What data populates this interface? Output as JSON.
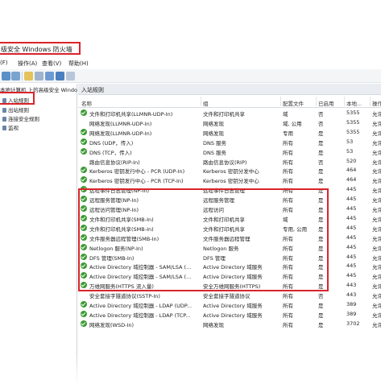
{
  "window": {
    "title": "级安全 Windows 防火墙"
  },
  "menu": [
    {
      "label": "(F)"
    },
    {
      "label": "操作(A)"
    },
    {
      "label": "查看(V)"
    },
    {
      "label": "帮助(H)"
    }
  ],
  "tree": {
    "root": "本地计算机 上的高级安全 Windows",
    "items": [
      {
        "label": "入站规则"
      },
      {
        "label": "出站规则"
      },
      {
        "label": "连接安全规则"
      },
      {
        "label": "监视"
      }
    ]
  },
  "panel": {
    "title": "入站规则"
  },
  "columns": [
    "名称",
    "组",
    "配置文件",
    "已启用",
    "本地...",
    "操作"
  ],
  "rules": [
    {
      "enabled": true,
      "name": "文件和打印机共享(LLMNR-UDP-In)",
      "group": "文件和打印机共享",
      "profile": "域",
      "active": "否",
      "port": "5355",
      "action": "允许"
    },
    {
      "enabled": false,
      "name": "网络发现(LLMNR-UDP-In)",
      "group": "网络发现",
      "profile": "域, 公用",
      "active": "否",
      "port": "5355",
      "action": "允许"
    },
    {
      "enabled": true,
      "name": "网络发现(LLMNR-UDP-In)",
      "group": "网络发现",
      "profile": "专用",
      "active": "是",
      "port": "5355",
      "action": "允许"
    },
    {
      "enabled": true,
      "name": "DNS (UDP，传入)",
      "group": "DNS 服务",
      "profile": "所有",
      "active": "是",
      "port": "53",
      "action": "允许"
    },
    {
      "enabled": true,
      "name": "DNS (TCP，传入)",
      "group": "DNS 服务",
      "profile": "所有",
      "active": "是",
      "port": "53",
      "action": "允许"
    },
    {
      "enabled": false,
      "name": "路由信息协议(RIP-In)",
      "group": "路由信息协议(RIP)",
      "profile": "所有",
      "active": "否",
      "port": "520",
      "action": "允许"
    },
    {
      "enabled": true,
      "name": "Kerberos 密钥发行中心 - PCR (UDP-In)",
      "group": "Kerberos 密钥分发中心",
      "profile": "所有",
      "active": "是",
      "port": "464",
      "action": "允许"
    },
    {
      "enabled": true,
      "name": "Kerberos 密钥发行中心 - PCR (TCP-In)",
      "group": "Kerberos 密钥分发中心",
      "profile": "所有",
      "active": "是",
      "port": "464",
      "action": "允许"
    },
    {
      "enabled": true,
      "name": "远程事件日志管理(NP-In)",
      "group": "远程事件日志管理",
      "profile": "所有",
      "active": "是",
      "port": "445",
      "action": "允许"
    },
    {
      "enabled": true,
      "name": "远程服务管理(NP-In)",
      "group": "远程服务管理",
      "profile": "所有",
      "active": "是",
      "port": "445",
      "action": "允许"
    },
    {
      "enabled": true,
      "name": "远程访问管理(NP-In)",
      "group": "远程访问",
      "profile": "所有",
      "active": "是",
      "port": "445",
      "action": "允许"
    },
    {
      "enabled": true,
      "name": "文件和打印机共享(SMB-In)",
      "group": "文件和打印机共享",
      "profile": "域",
      "active": "是",
      "port": "445",
      "action": "允许"
    },
    {
      "enabled": true,
      "name": "文件和打印机共享(SMB-In)",
      "group": "文件和打印机共享",
      "profile": "专用, 公用",
      "active": "是",
      "port": "445",
      "action": "允许"
    },
    {
      "enabled": true,
      "name": "文件服务器远程管理(SMB-In)",
      "group": "文件服务器远程管理",
      "profile": "所有",
      "active": "是",
      "port": "445",
      "action": "允许"
    },
    {
      "enabled": true,
      "name": "Netlogon 服务(NP-In)",
      "group": "Netlogon 服务",
      "profile": "所有",
      "active": "是",
      "port": "445",
      "action": "允许"
    },
    {
      "enabled": true,
      "name": "DFS 管理(SMB-In)",
      "group": "DFS 管理",
      "profile": "所有",
      "active": "是",
      "port": "445",
      "action": "允许"
    },
    {
      "enabled": true,
      "name": "Active Directory 域控制器 - SAM/LSA (...",
      "group": "Active Directory 域服务",
      "profile": "所有",
      "active": "是",
      "port": "445",
      "action": "允许"
    },
    {
      "enabled": true,
      "name": "Active Directory 域控制器 - SAM/LSA (...",
      "group": "Active Directory 域服务",
      "profile": "所有",
      "active": "是",
      "port": "445",
      "action": "允许"
    },
    {
      "enabled": true,
      "name": "万维网服务(HTTPS 流入量)",
      "group": "安全万维网服务(HTTPS)",
      "profile": "所有",
      "active": "是",
      "port": "443",
      "action": "允许"
    },
    {
      "enabled": false,
      "name": "安全套接字隧道协议(SSTP-In)",
      "group": "安全套接字隧道协议",
      "profile": "所有",
      "active": "否",
      "port": "443",
      "action": "允许"
    },
    {
      "enabled": true,
      "name": "Active Directory 域控制器 - LDAP (UDP...",
      "group": "Active Directory 域服务",
      "profile": "所有",
      "active": "是",
      "port": "389",
      "action": "允许"
    },
    {
      "enabled": true,
      "name": "Active Directory 域控制器 - LDAP (TCP...",
      "group": "Active Directory 域服务",
      "profile": "所有",
      "active": "是",
      "port": "389",
      "action": "允许"
    },
    {
      "enabled": true,
      "name": "网络发现(WSD-In)",
      "group": "网络发现",
      "profile": "所有",
      "active": "是",
      "port": "3702",
      "action": "允许"
    }
  ],
  "colors": {
    "highlight": "#d9242b",
    "check": "#3d9b36"
  }
}
